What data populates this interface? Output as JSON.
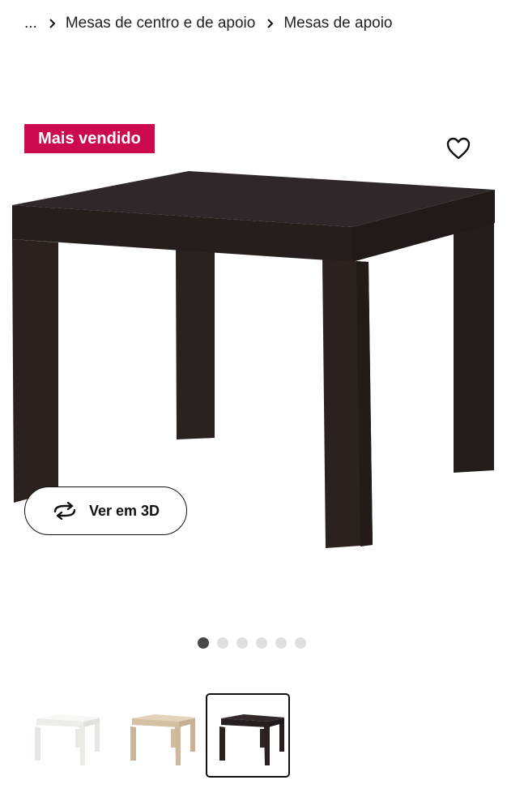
{
  "breadcrumb": {
    "ellipsis": "...",
    "items": [
      "Mesas de centro e de apoio",
      "Mesas de apoio"
    ]
  },
  "badge": {
    "label": "Mais vendido",
    "color": "#cc0b4f"
  },
  "product": {
    "main_color": "#2b2220"
  },
  "view_3d": {
    "label": "Ver em 3D"
  },
  "gallery": {
    "total_images": 6,
    "active_index": 0
  },
  "thumbnails": [
    {
      "variant": "white",
      "color": "#f2f2ef",
      "selected": false
    },
    {
      "variant": "oak-effect",
      "color": "#d9c4a8",
      "selected": false
    },
    {
      "variant": "black-brown",
      "color": "#2b2220",
      "selected": true
    }
  ]
}
